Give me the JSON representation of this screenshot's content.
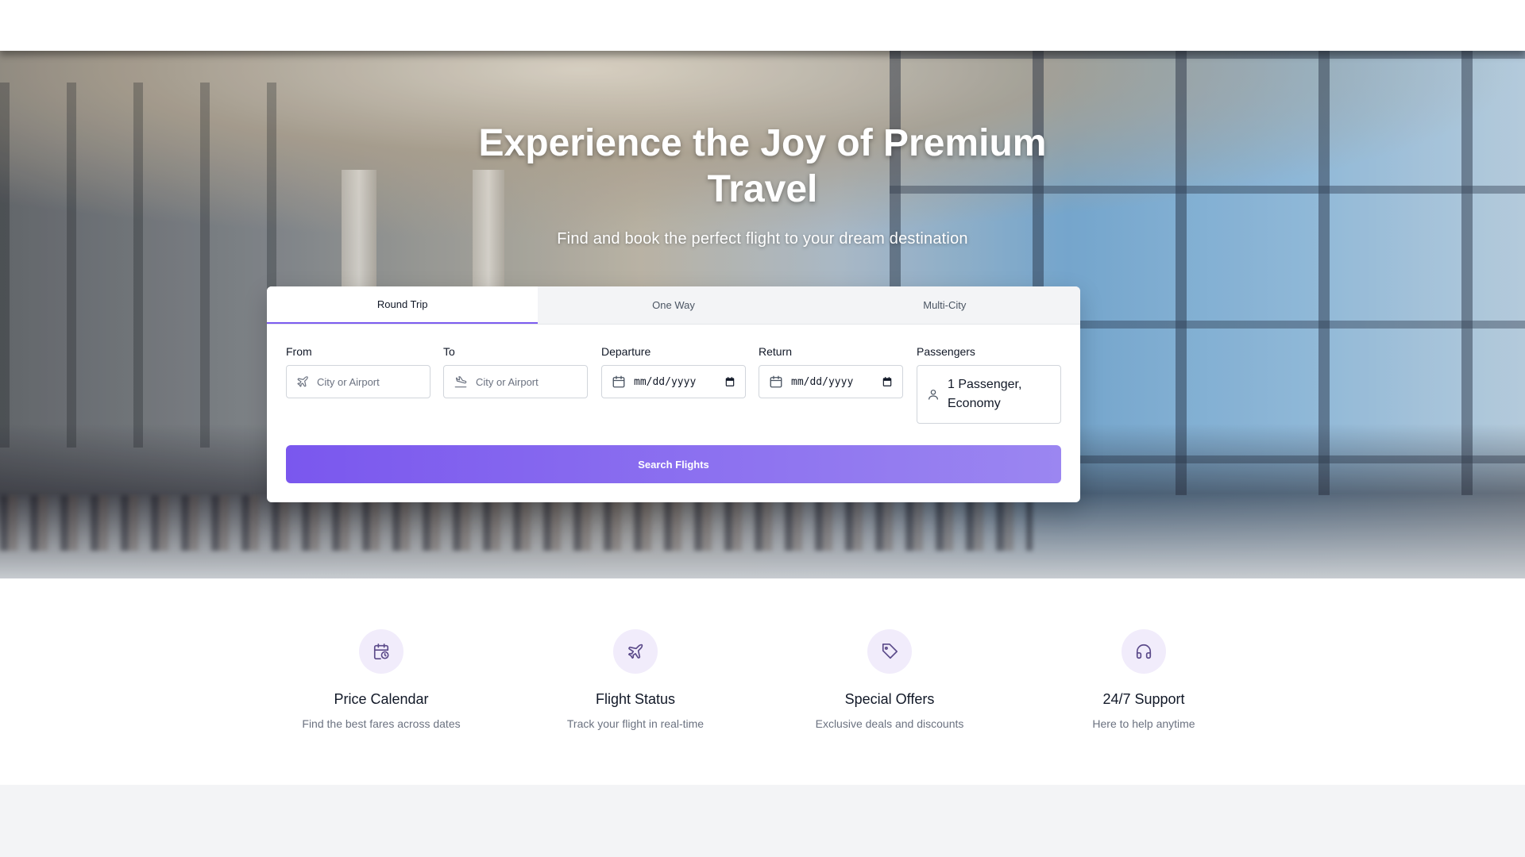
{
  "hero": {
    "title_line1": "Experience the Joy of Premium",
    "title_line2": "Travel",
    "subtitle": "Find and book the perfect flight to your dream destination"
  },
  "search": {
    "tabs": [
      {
        "label": "Round Trip",
        "active": true
      },
      {
        "label": "One Way",
        "active": false
      },
      {
        "label": "Multi-City",
        "active": false
      }
    ],
    "fields": {
      "from": {
        "label": "From",
        "placeholder": "City or Airport",
        "icon": "plane-takeoff-icon"
      },
      "to": {
        "label": "To",
        "placeholder": "City or Airport",
        "icon": "plane-landing-icon"
      },
      "departure": {
        "label": "Departure",
        "value": "mm/dd/yyyy",
        "icon": "calendar-icon"
      },
      "return": {
        "label": "Return",
        "value": "mm/dd/yyyy",
        "icon": "calendar-icon"
      },
      "passengers": {
        "label": "Passengers",
        "value_line1": "1 Passenger,",
        "value_line2": "Economy",
        "icon": "user-icon"
      }
    },
    "button_label": "Search Flights"
  },
  "features": [
    {
      "title": "Price Calendar",
      "description": "Find the best fares across dates",
      "icon": "calendar-clock-icon"
    },
    {
      "title": "Flight Status",
      "description": "Track your flight in real-time",
      "icon": "plane-icon"
    },
    {
      "title": "Special Offers",
      "description": "Exclusive deals and discounts",
      "icon": "tag-icon"
    },
    {
      "title": "24/7 Support",
      "description": "Here to help anytime",
      "icon": "headphones-icon"
    }
  ],
  "colors": {
    "accent": "#7c5cf0",
    "icon_bg": "#f1ecfb",
    "icon_fg": "#5b4a8a"
  }
}
